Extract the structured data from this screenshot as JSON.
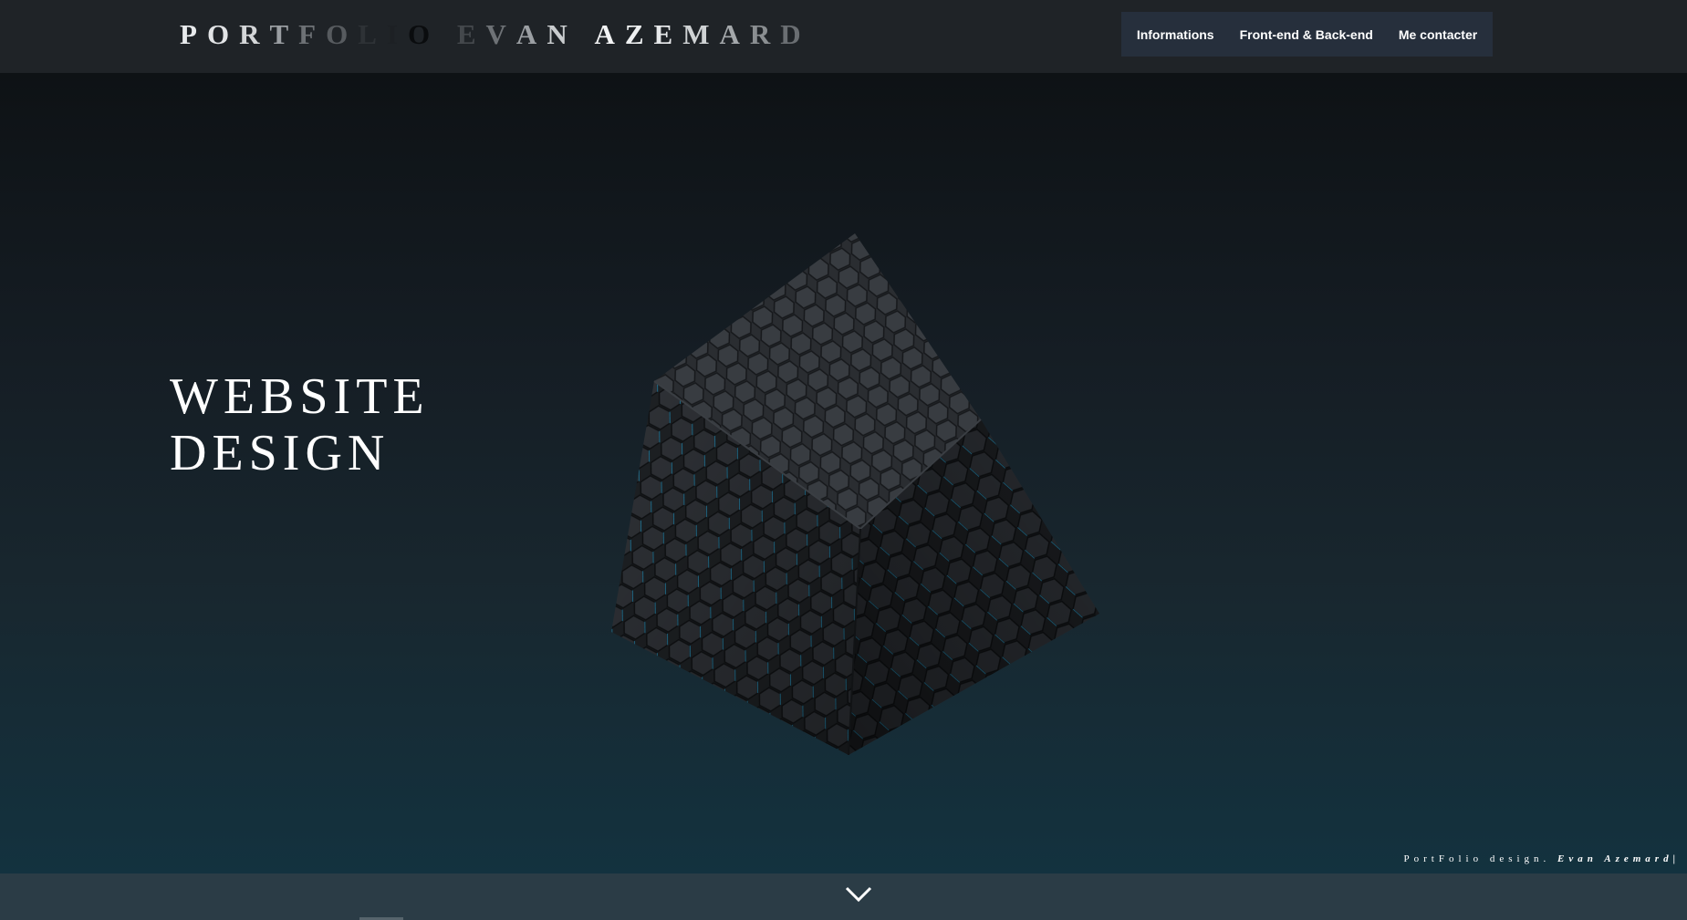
{
  "header": {
    "logo_letters": [
      "P",
      "O",
      "R",
      "T",
      "F",
      "O",
      "L",
      "I",
      "O",
      " ",
      "E",
      "V",
      "A",
      "N",
      " ",
      "A",
      "Z",
      "E",
      "M",
      "A",
      "R",
      "D"
    ],
    "logo_colors": [
      "#e8eaec",
      "#e2e4e6",
      "#d4d6d8",
      "#9a9ea2",
      "#6d7175",
      "#575b5f",
      "#2e3236",
      "#1d2024",
      "#0a0c0e",
      "#1f2327",
      "#44484c",
      "#6e7276",
      "#9b9fa3",
      "#c9ccce",
      "#1f2327",
      "#f2f3f4",
      "#eef0f1",
      "#e6e8ea",
      "#cfd2d4",
      "#a4a8ab",
      "#8a8e91",
      "#6a6e72"
    ]
  },
  "nav": {
    "items": [
      "Informations",
      "Front-end & Back-end",
      "Me contacter"
    ]
  },
  "hero": {
    "title_line1": "WEBSITE",
    "title_line2": "DESIGN"
  },
  "tagline": {
    "prefix": "PortFolio design.",
    "author": "Evan Azemard|"
  },
  "icons": {
    "scroll": "chevron-down-icon",
    "cube": "hexagon-cube-graphic"
  },
  "colors": {
    "header_bg": "#1f2327",
    "nav_bg": "#262f3c",
    "hero_top": "#0e1215",
    "hero_bottom": "#13323f",
    "bottom_bar": "#2b3c46",
    "accent_glow": "#2ea6d6"
  }
}
